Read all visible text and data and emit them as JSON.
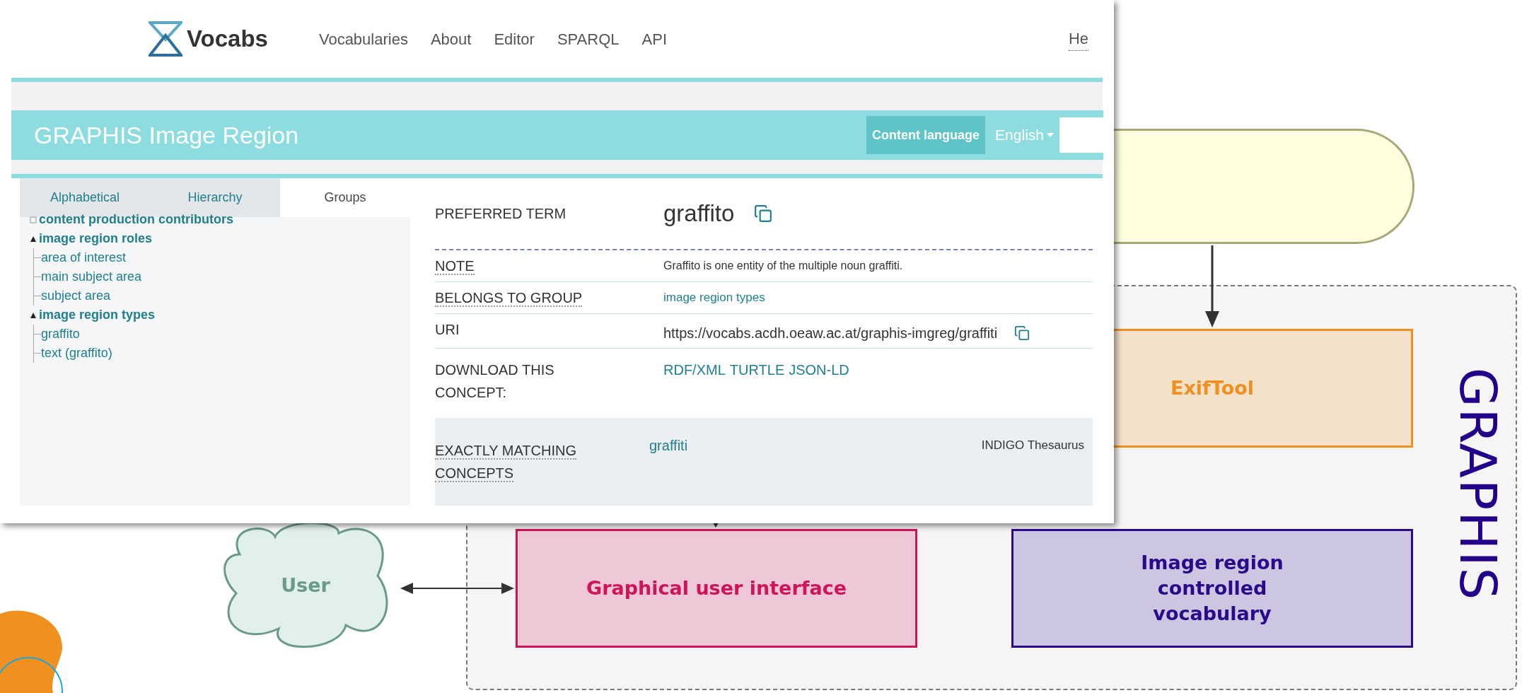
{
  "browser": {
    "logo": "Vocabs",
    "nav": [
      "Vocabularies",
      "About",
      "Editor",
      "SPARQL",
      "API"
    ],
    "nav_cut": "He"
  },
  "vocab_header": {
    "title": "GRAPHIS Image Region",
    "content_language": "Content language",
    "language": "English"
  },
  "tabs": [
    {
      "label": "Alphabetical",
      "selected": false
    },
    {
      "label": "Hierarchy",
      "selected": false
    },
    {
      "label": "Groups",
      "selected": true
    }
  ],
  "tree": [
    {
      "label": "content production contributors",
      "expanded": false
    },
    {
      "label": "image region roles",
      "expanded": true,
      "children": [
        {
          "label": "area of interest"
        },
        {
          "label": "main subject area"
        },
        {
          "label": "subject area"
        }
      ]
    },
    {
      "label": "image region types",
      "expanded": true,
      "children": [
        {
          "label": "graffito"
        },
        {
          "label": "text (graffito)"
        }
      ]
    }
  ],
  "concept": {
    "preferred_term": {
      "label": "PREFERRED TERM",
      "value": "graffito"
    },
    "properties": [
      {
        "kind": "text",
        "label": "NOTE",
        "underlined": true,
        "value": "Graffito is one entity of the multiple noun graffiti."
      },
      {
        "kind": "link",
        "label": "BELONGS TO GROUP",
        "underlined": true,
        "value": "image region types"
      },
      {
        "kind": "copy",
        "label": "URI",
        "underlined": false,
        "value": "https://vocabs.acdh.oeaw.ac.at/graphis-imgreg/graffiti"
      },
      {
        "kind": "links",
        "label": "DOWNLOAD THIS CONCEPT:",
        "underlined": false,
        "links": [
          "RDF/XML",
          "TURTLE",
          "JSON-LD"
        ]
      }
    ],
    "matches": {
      "label": "EXACTLY MATCHING CONCEPTS",
      "term": "graffiti",
      "source": "INDIGO Thesaurus"
    }
  },
  "diagram": {
    "logo": "GRAPHIS",
    "nodes": [
      {
        "kind": "terminator",
        "color": "#a8a878"
      },
      {
        "kind": "box",
        "label": "ExifTool",
        "color": "#f0901e"
      },
      {
        "kind": "cloud",
        "label": "User",
        "color": "#6a9a8a"
      },
      {
        "kind": "box",
        "label": "Graphical user interface",
        "color": "#d0145a"
      },
      {
        "kind": "box",
        "label": "Image region controlled vocabulary",
        "color": "#2a0a8a"
      }
    ]
  }
}
